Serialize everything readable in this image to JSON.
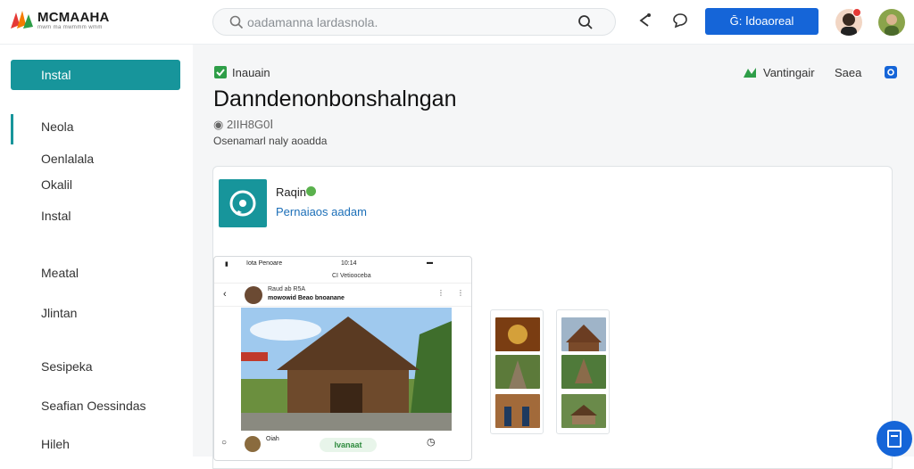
{
  "header": {
    "brand": "MCMAAHA",
    "brand_sub": "mwm ma mwmmm wmm",
    "search_placeholder": "oadamanna lardasnola.",
    "primary_button": "Ḡ:  Ⅰdoaoreal"
  },
  "sidebar": {
    "install_label": "Instal",
    "items": [
      "Neola",
      "Oenlalala",
      "Okalil",
      "Instal",
      "Meatal",
      "Jlintan",
      "Sesipeka",
      "Seafian Oessindas",
      "Hileh"
    ]
  },
  "main": {
    "kicker": "Inauain",
    "title": "Danndenonbonshalngan",
    "meta": "◉ 2IIH8G0Ⅰ",
    "subtitle": "Osenamarl naly aoadda",
    "actions": {
      "primary": "Vantingair",
      "secondary": "Saea"
    }
  },
  "card": {
    "app_name": "Raqin",
    "app_link": "Pernaiaos aadam",
    "phone": {
      "status_left": "Iota Penoare",
      "status_time": "10:14",
      "tab_label": "CI Vetiooceba",
      "post_author": "Raud ab R5A",
      "post_text": "mowowid Beao bnoanane",
      "footer_author": "Oiah",
      "footer_pill": "Ivanaat"
    }
  },
  "colors": {
    "accent": "#17959b",
    "primary": "#1565d8",
    "success": "#2e9e48",
    "link": "#1c6fb8"
  }
}
